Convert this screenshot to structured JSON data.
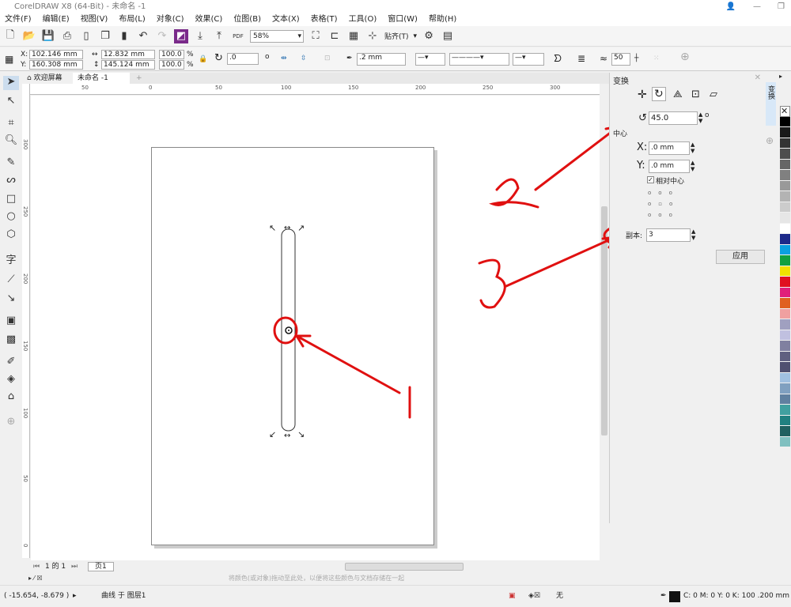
{
  "window": {
    "title": "CorelDRAW X8 (64-Bit) - 未命名 -1"
  },
  "menu": [
    "文件(F)",
    "编辑(E)",
    "视图(V)",
    "布局(L)",
    "对象(C)",
    "效果(C)",
    "位图(B)",
    "文本(X)",
    "表格(T)",
    "工具(O)",
    "窗口(W)",
    "帮助(H)"
  ],
  "toolbar": {
    "zoom": "58%",
    "snap_label": "贴齐(T)",
    "pdf": "PDF"
  },
  "propbar": {
    "x": "102.146 mm",
    "y": "160.308 mm",
    "x_label": "X:",
    "y_label": "Y:",
    "width": "12.832 mm",
    "height": "145.124 mm",
    "scale_x": "100.0",
    "scale_y": "100.0",
    "pct": "%",
    "rotation": ".0",
    "degree": "o",
    "outline_width": ".2 mm",
    "smoothing": "50"
  },
  "doc_tabs": [
    {
      "label": "欢迎屏幕"
    },
    {
      "label": "未命名 -1"
    }
  ],
  "ruler": {
    "top": [
      "50",
      "0",
      "50",
      "100",
      "150",
      "200",
      "250",
      "300"
    ],
    "left": [
      "300",
      "250",
      "200",
      "150",
      "100",
      "50",
      "0"
    ]
  },
  "docker": {
    "title": "变换",
    "rotation_angle": "45.0",
    "degree": "o",
    "center_label": "中心",
    "x_label": "X:",
    "x_value": ".0 mm",
    "y_label": "Y:",
    "y_value": ".0 mm",
    "relative_center": "相对中心",
    "relative_center_checked": true,
    "copies_label": "副本:",
    "copies": "3",
    "apply": "应用",
    "side_tab": "变换"
  },
  "annotations": {
    "n1": "1",
    "n2": "2",
    "n3": "3",
    "color": "#e01010"
  },
  "pager": {
    "info": "1 的 1",
    "page_tab": "页1"
  },
  "color_hint": "将颜色(或对象)拖动至此处，以便将这些颜色与文档存储在一起",
  "status": {
    "coords": "( -15.654, -8.679 )",
    "object": "曲线 于 图层1",
    "fill": "无",
    "outline": "C: 0 M: 0 Y: 0 K: 100  .200 mm"
  },
  "palette": [
    "#000000",
    "#1a1a1a",
    "#333333",
    "#4d4d4d",
    "#666666",
    "#808080",
    "#999999",
    "#b3b3b3",
    "#cccccc",
    "#e6e6e6",
    "#ffffff",
    "#1d2a8a",
    "#0aa0e0",
    "#10a040",
    "#f0e000",
    "#e01020",
    "#e0207a",
    "#e06020",
    "#f0a0a0",
    "#a0a0c0",
    "#c0c0e0",
    "#8080a0",
    "#606080",
    "#505070",
    "#a0c0e0",
    "#80a0c0",
    "#6080a0",
    "#40a0a0",
    "#208080",
    "#206060",
    "#80c0c0"
  ]
}
